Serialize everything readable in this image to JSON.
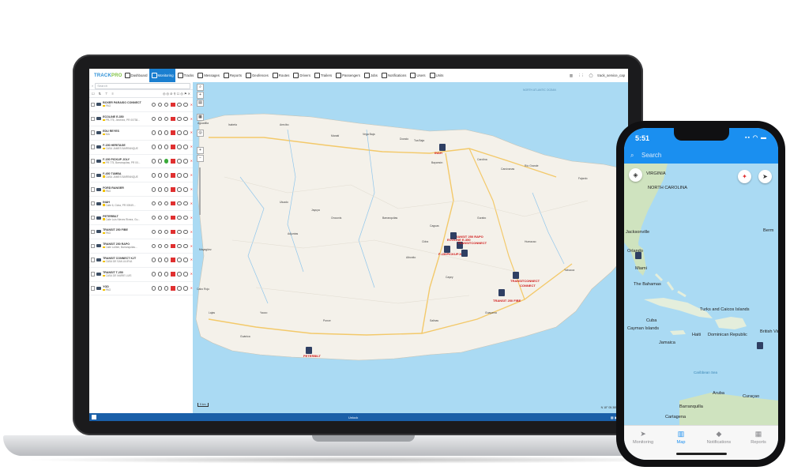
{
  "app": {
    "logo": "TRACK",
    "logo_suffix": "PRO",
    "nav": [
      {
        "label": "Dashboard",
        "icon": "dashboard-icon",
        "active": false
      },
      {
        "label": "Monitoring",
        "icon": "monitoring-icon",
        "active": true
      },
      {
        "label": "Tracks",
        "icon": "tracks-icon",
        "active": false
      },
      {
        "label": "Messages",
        "icon": "messages-icon",
        "active": false
      },
      {
        "label": "Reports",
        "icon": "reports-icon",
        "active": false
      },
      {
        "label": "Geofences",
        "icon": "geofences-icon",
        "active": false
      },
      {
        "label": "Routes",
        "icon": "routes-icon",
        "active": false
      },
      {
        "label": "Drivers",
        "icon": "drivers-icon",
        "active": false
      },
      {
        "label": "Trailers",
        "icon": "trailers-icon",
        "active": false
      },
      {
        "label": "Passengers",
        "icon": "passengers-icon",
        "active": false
      },
      {
        "label": "Jobs",
        "icon": "jobs-icon",
        "active": false
      },
      {
        "label": "Notifications",
        "icon": "notifications-icon",
        "active": false
      },
      {
        "label": "Users",
        "icon": "users-icon",
        "active": false
      },
      {
        "label": "Units",
        "icon": "units-icon",
        "active": false
      }
    ],
    "user": "track_service_cap"
  },
  "sidebar": {
    "search_placeholder": "Search",
    "units": [
      {
        "name": "BOXER PARAISO CONNECT",
        "address": "PAG"
      },
      {
        "name": "ECOLINE E-350",
        "address": "PR-775, Jímenez, PR 00738..."
      },
      {
        "name": "EDU REYES",
        "address": "N/A"
      },
      {
        "name": "F-150 HERITAGE",
        "address": "CASA JAMES BARRANQUE"
      },
      {
        "name": "F-150 PICKUP JOLY",
        "address": "PR 775, Barranquitas, PR 00..."
      },
      {
        "name": "F-450 TUMBA",
        "address": "CASA JAMES BARRANQUE"
      },
      {
        "name": "FORD RANGER",
        "address": "PAG"
      },
      {
        "name": "INAH",
        "address": "Calle 6, Cidra, PR 00949..."
      },
      {
        "name": "PETERBILT",
        "address": "Calle Luis Nieves Rivera, Gu..."
      },
      {
        "name": "TRANSIT 250 FIBE",
        "address": "PAG"
      },
      {
        "name": "TRANSIT 250 RAPO",
        "address": "Calle Lollber, Barranquitas..."
      },
      {
        "name": "TRANSIT CONNECT KJT",
        "address": "CASA DE SAN LILIEVA"
      },
      {
        "name": "TRANSIT T-250",
        "address": "CASA DE MARIE LUIS"
      },
      {
        "name": "YOD",
        "address": "PAG"
      }
    ]
  },
  "map": {
    "places": [
      {
        "name": "Aguadilla"
      },
      {
        "name": "Isabela"
      },
      {
        "name": "Arecibo"
      },
      {
        "name": "Manatí"
      },
      {
        "name": "Vega Baja"
      },
      {
        "name": "Dorado"
      },
      {
        "name": "Toa Baja"
      },
      {
        "name": "Bayamón"
      },
      {
        "name": "Carolina"
      },
      {
        "name": "Canóvanas"
      },
      {
        "name": "Río Grande"
      },
      {
        "name": "Fajardo"
      },
      {
        "name": "Mayagüez"
      },
      {
        "name": "Utuado"
      },
      {
        "name": "Orocovis"
      },
      {
        "name": "Cayey"
      },
      {
        "name": "Caguas"
      },
      {
        "name": "Humacao"
      },
      {
        "name": "Yabucoa"
      },
      {
        "name": "Guayama"
      },
      {
        "name": "Salinas"
      },
      {
        "name": "Ponce"
      },
      {
        "name": "Yauco"
      },
      {
        "name": "Guánica"
      },
      {
        "name": "Cabo Rojo"
      },
      {
        "name": "Lajas"
      },
      {
        "name": "Adjuntas"
      },
      {
        "name": "Jayuya"
      },
      {
        "name": "Barranquitas"
      },
      {
        "name": "Aibonito"
      },
      {
        "name": "Cidra"
      },
      {
        "name": "Gurabo"
      }
    ],
    "vehicles": [
      {
        "label": "INAH"
      },
      {
        "label": "ECOLINE E-350"
      },
      {
        "label": "TRANSIT 250 RAPO"
      },
      {
        "label": "TRANSITCONNECT"
      },
      {
        "label": "F-150PICKUPJOLY"
      },
      {
        "label": "TRANSIT 250 FIBE"
      },
      {
        "label": "TRANSITCONNECT"
      },
      {
        "label": "CONNECT"
      },
      {
        "label": "PETERBILT"
      }
    ],
    "sea_top": "NORTH ATLANTIC OCEAN",
    "scale": "5 km",
    "coords": "N 18° 05.3858' E"
  },
  "taskbar": {
    "center": "Unlock"
  },
  "phone": {
    "time": "5:51",
    "status_icons": "▪▪ ◠ ▬",
    "search_placeholder": "Search",
    "places": [
      {
        "name": "VIRGINIA"
      },
      {
        "name": "NORTH CAROLINA"
      },
      {
        "name": "Jacksonville"
      },
      {
        "name": "Orlando"
      },
      {
        "name": "Miami"
      },
      {
        "name": "The Bahamas"
      },
      {
        "name": "Cuba"
      },
      {
        "name": "Turks and Caicos Islands"
      },
      {
        "name": "Cayman Islands"
      },
      {
        "name": "Jamaica"
      },
      {
        "name": "Haiti"
      },
      {
        "name": "Dominican Republic"
      },
      {
        "name": "British Virgin"
      },
      {
        "name": "Aruba"
      },
      {
        "name": "Curaçao"
      },
      {
        "name": "Barranquilla"
      },
      {
        "name": "Caribbean Sea"
      },
      {
        "name": "Berm"
      },
      {
        "name": "Cartagena"
      }
    ],
    "tabs": [
      {
        "label": "Monitoring",
        "icon": "navigation-arrow-icon",
        "active": false
      },
      {
        "label": "Map",
        "icon": "map-icon",
        "active": true
      },
      {
        "label": "Notifications",
        "icon": "bell-icon",
        "active": false
      },
      {
        "label": "Reports",
        "icon": "reports-grid-icon",
        "active": false
      }
    ]
  },
  "colors": {
    "accent": "#1b7fd0",
    "phone_accent": "#1a8ff0",
    "vehicle_label": "#d01919",
    "water": "#aadaf3",
    "land": "#f4f1ea"
  }
}
